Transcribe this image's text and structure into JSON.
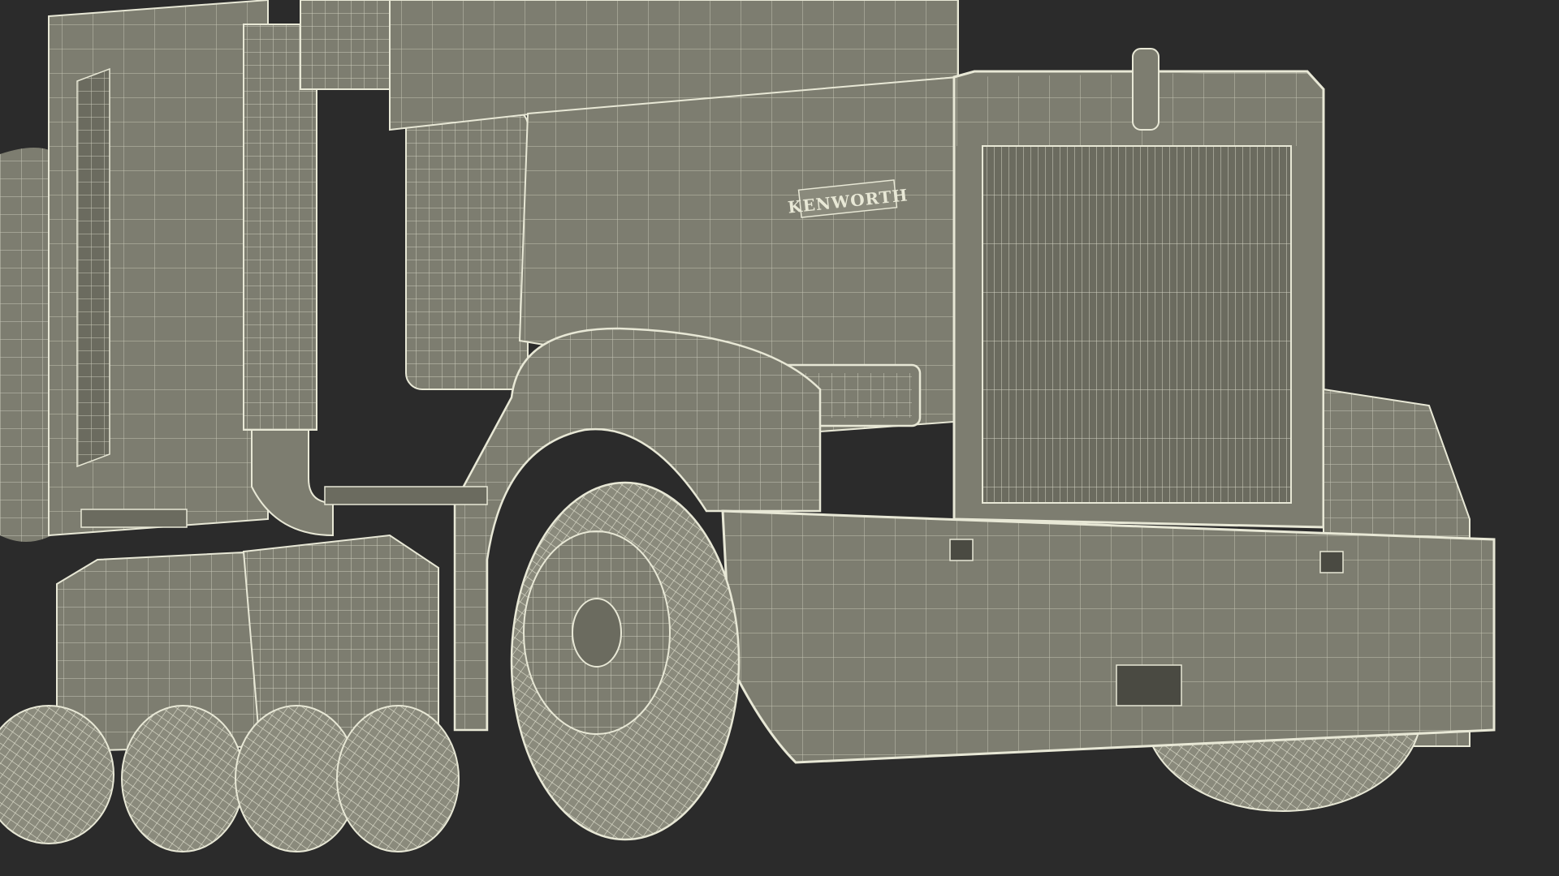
{
  "scene": {
    "background_color": "#2b2b2b",
    "body_color": "#7d7d70",
    "body_shadow_color": "#6b6b5f",
    "wire_color": "#e8e8d6",
    "tire_color": "#8a8a7c"
  },
  "badge": {
    "text": "KENWORTH"
  }
}
